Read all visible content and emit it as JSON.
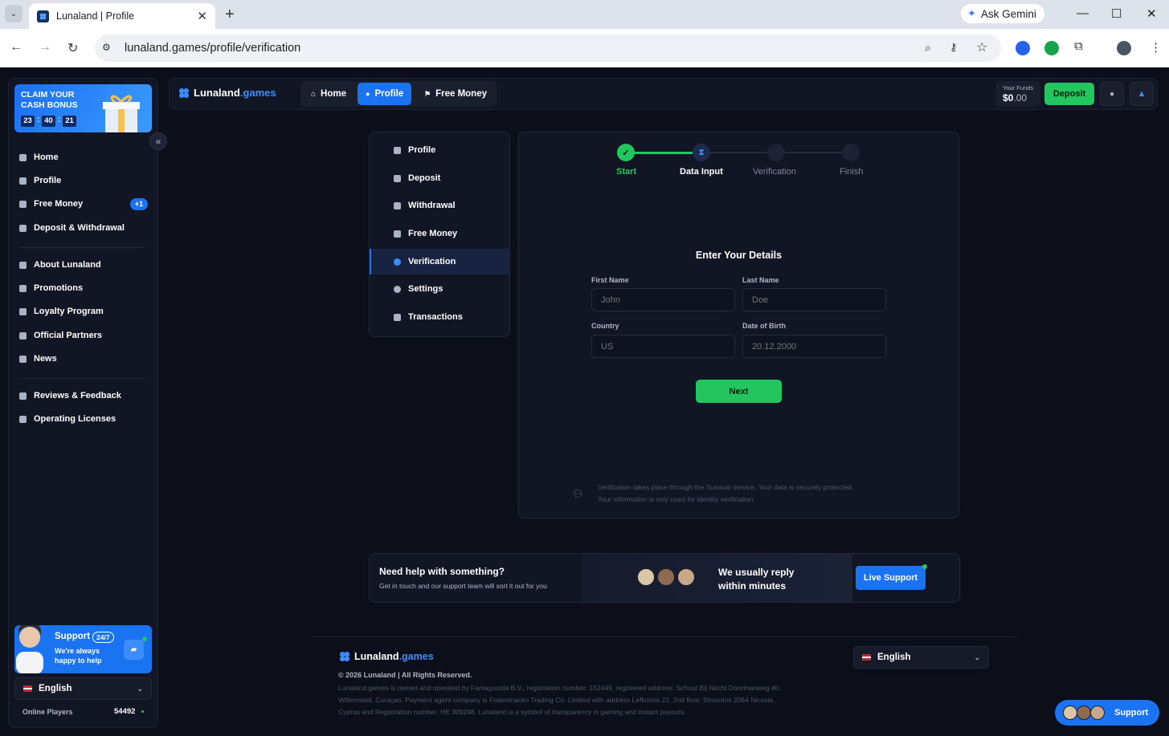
{
  "browser": {
    "tab_title": "Lunaland | Profile",
    "url": "lunaland.games/profile/verification",
    "gemini_label": "Ask Gemini"
  },
  "brand": {
    "name_a": "Lunaland",
    "name_b": ".games",
    "accent": "#1a73f0",
    "green": "#22c55e"
  },
  "sidebar": {
    "promo": {
      "line1": "CLAIM YOUR",
      "line2": "CASH BONUS",
      "hh": "23",
      "mm": "40",
      "ss": "21"
    },
    "items": [
      {
        "label": "Home",
        "icon": "home-icon"
      },
      {
        "label": "Profile",
        "icon": "user-icon"
      },
      {
        "label": "Free Money",
        "icon": "gift-icon",
        "badge": "+1"
      },
      {
        "label": "Deposit & Withdrawal",
        "icon": "wallet-icon"
      },
      {
        "label": "About Lunaland",
        "icon": "clover-icon"
      },
      {
        "label": "Promotions",
        "icon": "gift-box-icon"
      },
      {
        "label": "Loyalty Program",
        "icon": "trophy-icon"
      },
      {
        "label": "Official Partners",
        "icon": "briefcase-icon"
      },
      {
        "label": "News",
        "icon": "megaphone-icon"
      },
      {
        "label": "Reviews & Feedback",
        "icon": "chat-icon"
      },
      {
        "label": "Operating Licenses",
        "icon": "shield-icon"
      }
    ],
    "support": {
      "title": "Support",
      "badge": "24/7",
      "line1": "We're always",
      "line2": "happy to help"
    },
    "language": "English",
    "online_label": "Online Players",
    "online_count": "54492"
  },
  "topnav": {
    "tabs": [
      {
        "label": "Home"
      },
      {
        "label": "Profile"
      },
      {
        "label": "Free Money"
      }
    ],
    "funds_label": "Your Funds",
    "funds_whole": "$0",
    "funds_cents": ".00",
    "deposit_label": "Deposit"
  },
  "profile_menu": [
    "Profile",
    "Deposit",
    "Withdrawal",
    "Free Money",
    "Verification",
    "Settings",
    "Transactions"
  ],
  "stepper": {
    "steps": [
      "Start",
      "Data Input",
      "Verification",
      "Finish"
    ],
    "current": 1
  },
  "form": {
    "title": "Enter Your Details",
    "first_name_label": "First Name",
    "first_name_placeholder": "John",
    "last_name_label": "Last Name",
    "last_name_placeholder": "Doe",
    "country_label": "Country",
    "country_placeholder": "US",
    "dob_label": "Date of Birth",
    "dob_placeholder": "20.12.2000",
    "next_label": "Next",
    "note1": "Verification takes place through the Sumsub service. Your data is securely protected.",
    "note2": "Your information is only used for identity verification."
  },
  "help": {
    "title": "Need help with something?",
    "sub": "Get in touch and our support team will sort it out for you",
    "reply1": "We usually reply",
    "reply2": "within minutes",
    "button": "Live Support"
  },
  "footer": {
    "copyright": "© 2026 Lunaland | All Rights Reserved.",
    "legal1": "Lunaland.games is owned and operated by Famagousta B.V., registration number: 152449, registered address: Schout Bij Nacht Doormanweg 40,",
    "legal2": "Willemstad, Curaçao. Payment agent company is Fodenmacko Trading Co. Limited with address Lefkonos 22, 2nd floor, Strovolos 2064 Nicosia,",
    "legal3": "Cyprus and Registration number: HE 309248. Lunaland is a symbol of transparency in gaming and instant payouts.",
    "language": "English",
    "support_label": "Support"
  }
}
